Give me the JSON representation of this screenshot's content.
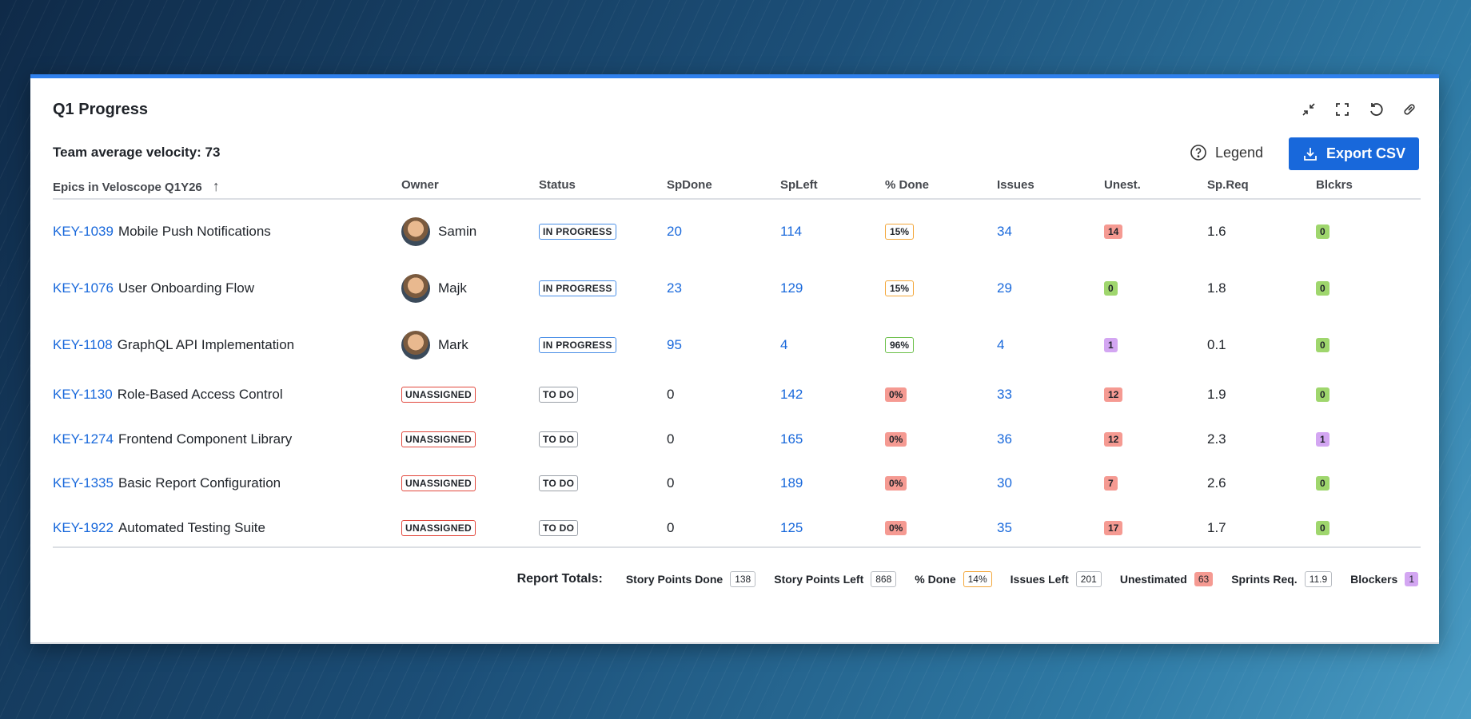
{
  "title": "Q1 Progress",
  "velocity": "Team average velocity: 73",
  "legend_label": "Legend",
  "export_label": "Export CSV",
  "columns": [
    "Epics in Veloscope Q1Y26",
    "Owner",
    "Status",
    "SpDone",
    "SpLeft",
    "% Done",
    "Issues",
    "Unest.",
    "Sp.Req",
    "Blckrs"
  ],
  "rows": [
    {
      "key": "KEY-1039",
      "name": "Mobile Push Notifications",
      "owner": "Samin",
      "status": "IN PROGRESS",
      "spdone": "20",
      "spleft": "114",
      "pct": "15%",
      "issues": "34",
      "unest": "14",
      "spreq": "1.6",
      "blockers": "0"
    },
    {
      "key": "KEY-1076",
      "name": "User Onboarding Flow",
      "owner": "Majk",
      "status": "IN PROGRESS",
      "spdone": "23",
      "spleft": "129",
      "pct": "15%",
      "issues": "29",
      "unest": "0",
      "spreq": "1.8",
      "blockers": "0"
    },
    {
      "key": "KEY-1108",
      "name": "GraphQL API Implementation",
      "owner": "Mark",
      "status": "IN PROGRESS",
      "spdone": "95",
      "spleft": "4",
      "pct": "96%",
      "issues": "4",
      "unest": "1",
      "spreq": "0.1",
      "blockers": "0"
    },
    {
      "key": "KEY-1130",
      "name": "Role-Based Access Control",
      "owner": "UNASSIGNED",
      "status": "TO DO",
      "spdone": "0",
      "spleft": "142",
      "pct": "0%",
      "issues": "33",
      "unest": "12",
      "spreq": "1.9",
      "blockers": "0"
    },
    {
      "key": "KEY-1274",
      "name": "Frontend Component Library",
      "owner": "UNASSIGNED",
      "status": "TO DO",
      "spdone": "0",
      "spleft": "165",
      "pct": "0%",
      "issues": "36",
      "unest": "12",
      "spreq": "2.3",
      "blockers": "1"
    },
    {
      "key": "KEY-1335",
      "name": "Basic Report Configuration",
      "owner": "UNASSIGNED",
      "status": "TO DO",
      "spdone": "0",
      "spleft": "189",
      "pct": "0%",
      "issues": "30",
      "unest": "7",
      "spreq": "2.6",
      "blockers": "0"
    },
    {
      "key": "KEY-1922",
      "name": "Automated Testing Suite",
      "owner": "UNASSIGNED",
      "status": "TO DO",
      "spdone": "0",
      "spleft": "125",
      "pct": "0%",
      "issues": "35",
      "unest": "17",
      "spreq": "1.7",
      "blockers": "0"
    }
  ],
  "totals": {
    "label": "Report Totals:",
    "items": [
      {
        "label": "Story Points Done",
        "value": "138",
        "style": "gray"
      },
      {
        "label": "Story Points Left",
        "value": "868",
        "style": "gray"
      },
      {
        "label": "% Done",
        "value": "14%",
        "style": "orange"
      },
      {
        "label": "Issues Left",
        "value": "201",
        "style": "gray"
      },
      {
        "label": "Unestimated",
        "value": "63",
        "style": "red"
      },
      {
        "label": "Sprints Req.",
        "value": "11.9",
        "style": "gray"
      },
      {
        "label": "Blockers",
        "value": "1",
        "style": "purple"
      }
    ]
  }
}
